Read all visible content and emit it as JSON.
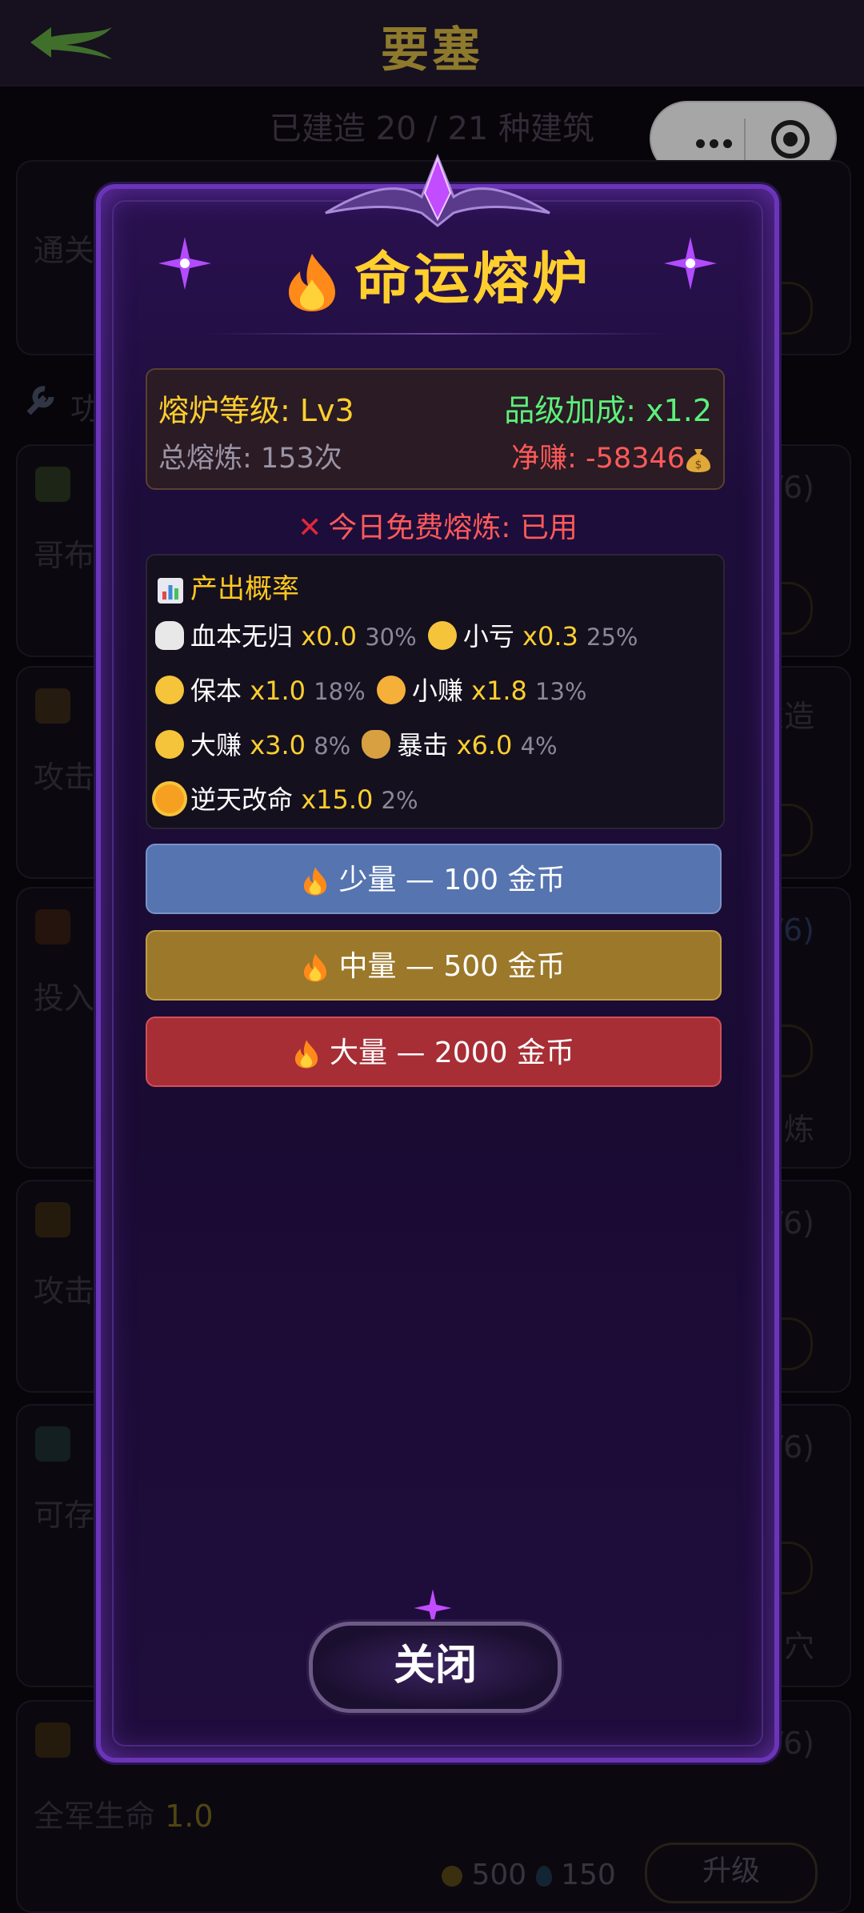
{
  "topbar": {
    "title": "要塞"
  },
  "subheader": "已建造 20 / 21 种建筑",
  "background": {
    "card_snippets": [
      "通关",
      "哥布",
      "攻击",
      "投入",
      "攻击",
      "可存",
      "全军生命"
    ],
    "section_label": "功",
    "right_snippets": [
      "1/6)",
      "建造",
      "3/6)",
      "炼",
      "1/6)",
      "1/6)",
      "穴",
      "1/6)"
    ],
    "bottom_row": {
      "value_label": "1.0",
      "gold_cost": "500",
      "gem_cost": "150",
      "upgrade_label": "升级"
    }
  },
  "modal": {
    "title": "命运熔炉",
    "stats": {
      "level_label": "熔炉等级: Lv3",
      "bonus_label": "品级加成: x1.2",
      "total_label": "总熔炼: 153次",
      "net_label": "净赚: -58346",
      "net_icon": "moneybag-icon"
    },
    "notice": "今日免费熔炼: 已用",
    "prob": {
      "header": "产出概率",
      "rows": [
        [
          {
            "name": "血本无归",
            "mult": "x0.0",
            "pct": "30%",
            "icon": "skull-icon"
          },
          {
            "name": "小亏",
            "mult": "x0.3",
            "pct": "25%",
            "icon": "crying-face-icon"
          }
        ],
        [
          {
            "name": "保本",
            "mult": "x1.0",
            "pct": "18%",
            "icon": "neutral-face-icon"
          },
          {
            "name": "小赚",
            "mult": "x1.8",
            "pct": "13%",
            "icon": "smile-face-icon"
          }
        ],
        [
          {
            "name": "大赚",
            "mult": "x3.0",
            "pct": "8%",
            "icon": "money-face-icon"
          },
          {
            "name": "暴击",
            "mult": "x6.0",
            "pct": "4%",
            "icon": "moneybag-icon"
          }
        ],
        [
          {
            "name": "逆天改命",
            "mult": "x15.0",
            "pct": "2%",
            "icon": "sun-icon"
          }
        ]
      ]
    },
    "buttons": {
      "small": "少量 — 100 金币",
      "medium": "中量 — 500 金币",
      "large": "大量 — 2000 金币"
    },
    "close_label": "关闭"
  },
  "colors": {
    "gold": "#ffcf2e",
    "positive": "#5cf07a",
    "negative": "#ff5a5a",
    "btn_small": "#5574b0",
    "btn_mid": "#9b782a",
    "btn_big": "#a72e35"
  }
}
